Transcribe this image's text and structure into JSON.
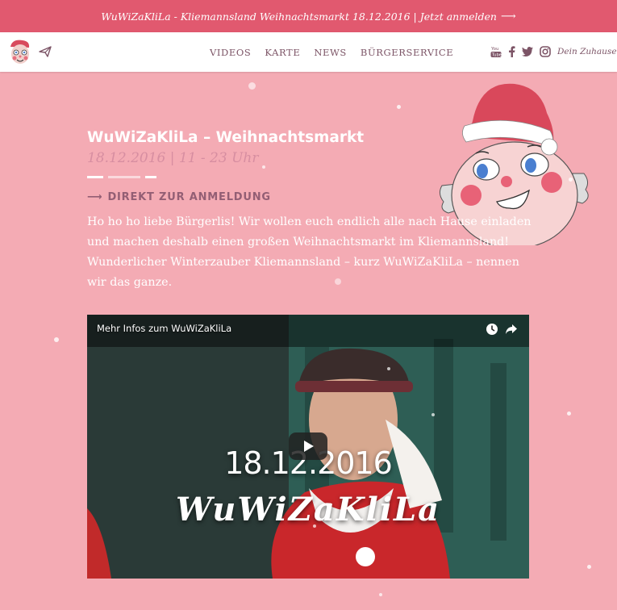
{
  "topbar": {
    "text": "WuWiZaKliLa - Kliemannsland Weihnachtsmarkt 18.12.2016 | Jetzt anmelden",
    "arrow": "⟶"
  },
  "nav": {
    "items": [
      {
        "label": "VIDEOS"
      },
      {
        "label": "KARTE"
      },
      {
        "label": "NEWS"
      },
      {
        "label": "BÜRGERSERVICE"
      }
    ],
    "social": [
      "youtube-icon",
      "facebook-icon",
      "twitter-icon",
      "instagram-icon"
    ],
    "home_label": "Dein Zuhause"
  },
  "event": {
    "title": "WuWiZaKliLa – Weihnachtsmarkt",
    "date": "18.12.2016 | 11 - 23 Uhr",
    "cta": "DIREKT ZUR ANMELDUNG",
    "cta_arrow": "⟶",
    "intro": "Ho ho ho liebe Bürgerlis! Wir wollen euch endlich alle nach Hause einladen und machen deshalb einen großen Weihnachtsmarkt im Kliemannsland! Wunderlicher Winterzauber Kliemannsland – kurz WuWiZaKliLa – nennen wir das ganze."
  },
  "video": {
    "title": "Mehr Infos zum WuWiZaKliLa",
    "overlay_date": "18.12.2016",
    "overlay_brand": "WuWiZaKliLa"
  },
  "colors": {
    "background": "#f4abb4",
    "topbar": "#e1596f",
    "nav_text": "#7c5466",
    "subtitle": "#d78ea1",
    "cta": "#935e74"
  }
}
